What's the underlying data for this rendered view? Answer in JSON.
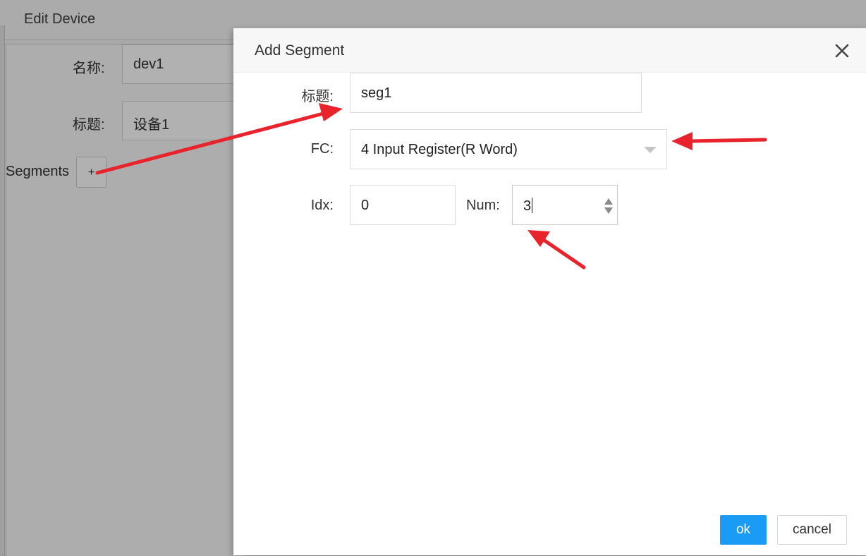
{
  "background_window": {
    "title": "Edit Device",
    "name_label": "名称:",
    "name_value": "dev1",
    "title_label": "标题:",
    "title_value": "设备1",
    "segments_label": "Segments",
    "add_button_label": "+"
  },
  "dialog": {
    "title": "Add Segment",
    "close_icon": "close-icon",
    "fields": {
      "title_label": "标题:",
      "title_value": "seg1",
      "fc_label": "FC:",
      "fc_value": "4 Input Register(R Word)",
      "idx_label": "Idx:",
      "idx_value": "0",
      "num_label": "Num:",
      "num_value": "3"
    },
    "ok_label": "ok",
    "cancel_label": "cancel"
  },
  "colors": {
    "primary": "#1a9bf5",
    "annotation_arrow": "#e8232b",
    "overlay": "#a9a9a9"
  }
}
